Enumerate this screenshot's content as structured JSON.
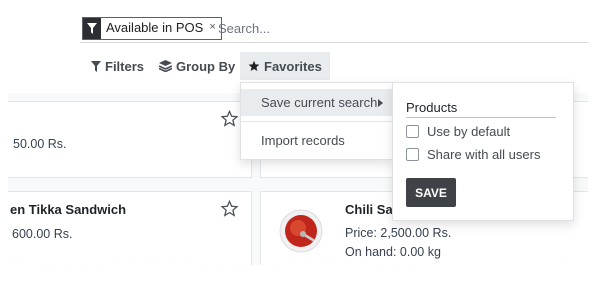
{
  "search": {
    "facet": {
      "icon": "filter-icon",
      "label": "Available in POS",
      "remove": "×"
    },
    "placeholder": "Search..."
  },
  "toolbar": {
    "filters": "Filters",
    "group_by": "Group By",
    "favorites": "Favorites"
  },
  "favorites_menu": {
    "items": [
      {
        "label": "Save current search",
        "has_submenu": true,
        "highlighted": true
      },
      {
        "label": "Import records",
        "has_submenu": false,
        "highlighted": false
      }
    ]
  },
  "save_search_panel": {
    "name_value": "Products",
    "use_by_default": {
      "label": "Use by default",
      "checked": false
    },
    "share_all": {
      "label": "Share with all users",
      "checked": false
    },
    "save_label": "SAVE"
  },
  "products": [
    {
      "title": "",
      "price": "50.00 Rs.",
      "on_hand": ""
    },
    {
      "title": "en Tikka Sandwich",
      "price": "600.00 Rs.",
      "on_hand": ""
    },
    {
      "title": "Chili Sa",
      "price": "Price: 2,500.00 Rs.",
      "on_hand": "On hand: 0.00 kg"
    }
  ],
  "colors": {
    "accent_dark": "#3f4347",
    "highlight": "#e9ecef",
    "background": "#f8f9fa"
  }
}
